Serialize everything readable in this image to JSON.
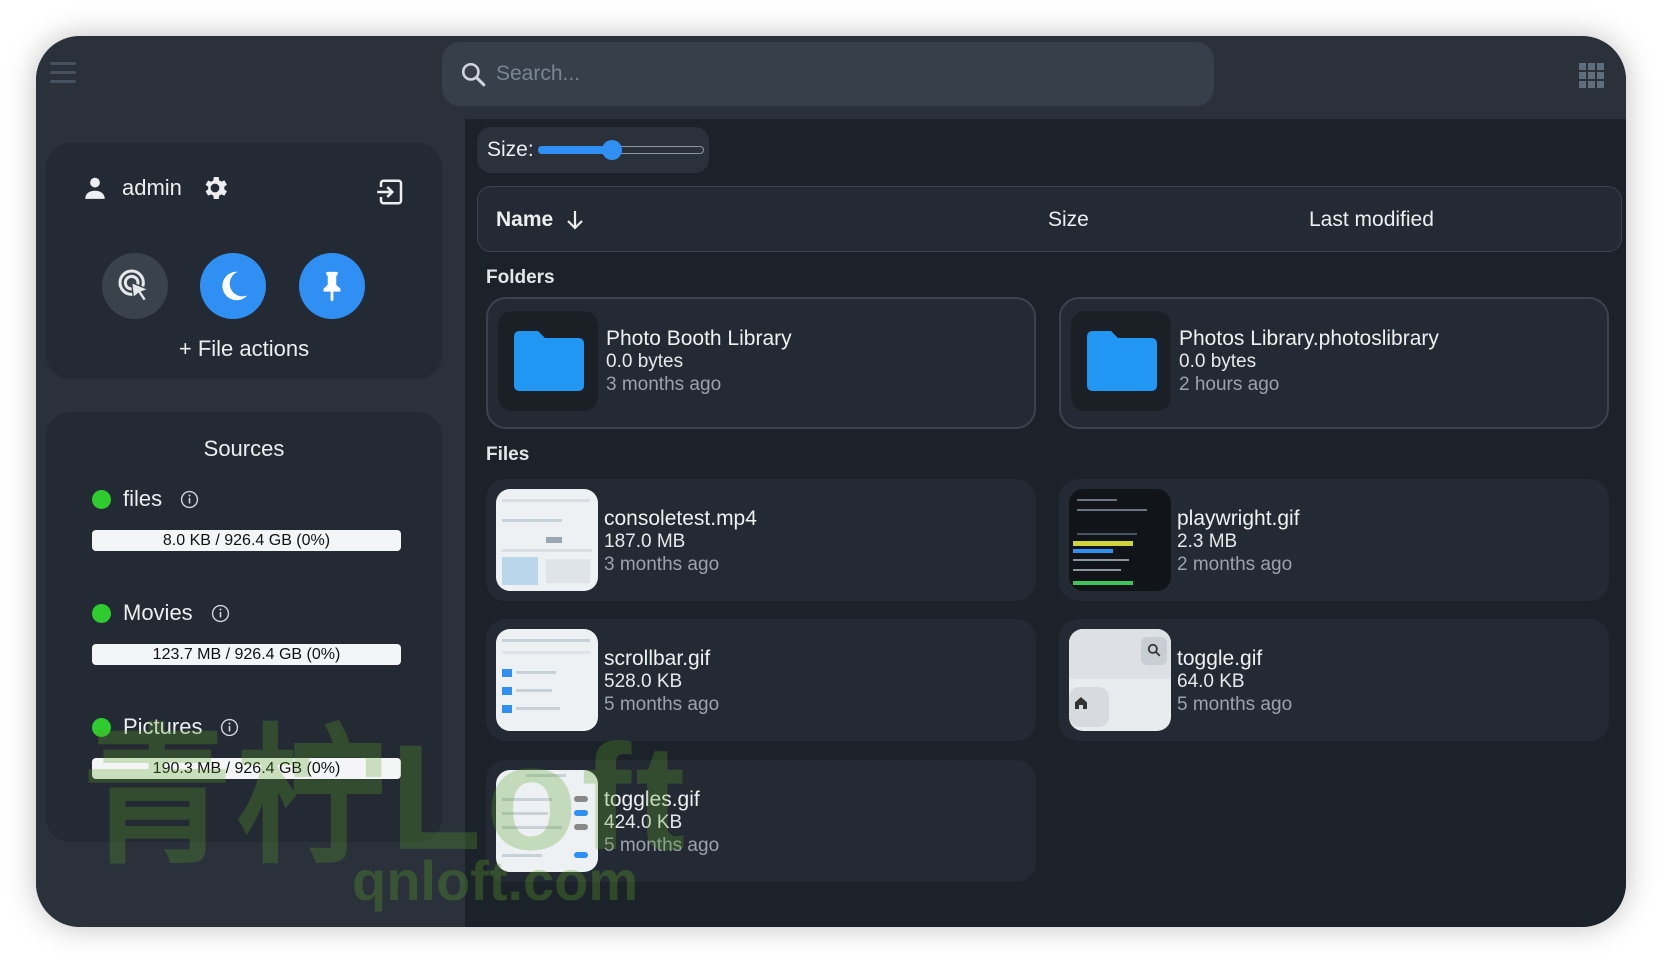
{
  "search": {
    "placeholder": "Search..."
  },
  "user": {
    "name": "admin",
    "file_actions_label": "+ File actions"
  },
  "sources": {
    "title": "Sources",
    "items": [
      {
        "name": "files",
        "usage": "8.0 KB / 926.4 GB (0%)",
        "percent": 0
      },
      {
        "name": "Movies",
        "usage": "123.7 MB / 926.4 GB (0%)",
        "percent": 0
      },
      {
        "name": "Pictures",
        "usage": "190.3 MB / 926.4 GB (0%)",
        "percent": 0
      }
    ]
  },
  "size_control": {
    "label": "Size:",
    "value_fraction": 0.45
  },
  "columns": {
    "name": "Name",
    "size": "Size",
    "modified": "Last modified"
  },
  "folders_label": "Folders",
  "files_label": "Files",
  "folders": [
    {
      "name": "Photo Booth Library",
      "size": "0.0 bytes",
      "modified": "3 months ago"
    },
    {
      "name": "Photos Library.photoslibrary",
      "size": "0.0 bytes",
      "modified": "2 hours ago"
    }
  ],
  "files": [
    {
      "name": "consoletest.mp4",
      "size": "187.0 MB",
      "modified": "3 months ago"
    },
    {
      "name": "playwright.gif",
      "size": "2.3 MB",
      "modified": "2 months ago"
    },
    {
      "name": "scrollbar.gif",
      "size": "528.0 KB",
      "modified": "5 months ago"
    },
    {
      "name": "toggle.gif",
      "size": "64.0 KB",
      "modified": "5 months ago"
    },
    {
      "name": "toggles.gif",
      "size": "424.0 KB",
      "modified": "5 months ago"
    }
  ],
  "watermark": {
    "text": "青柠Loft",
    "subtext": "qnloft.com"
  },
  "colors": {
    "accent": "#2f8ff3",
    "source_ok": "#2ecc2e",
    "folder": "#2196f3"
  }
}
